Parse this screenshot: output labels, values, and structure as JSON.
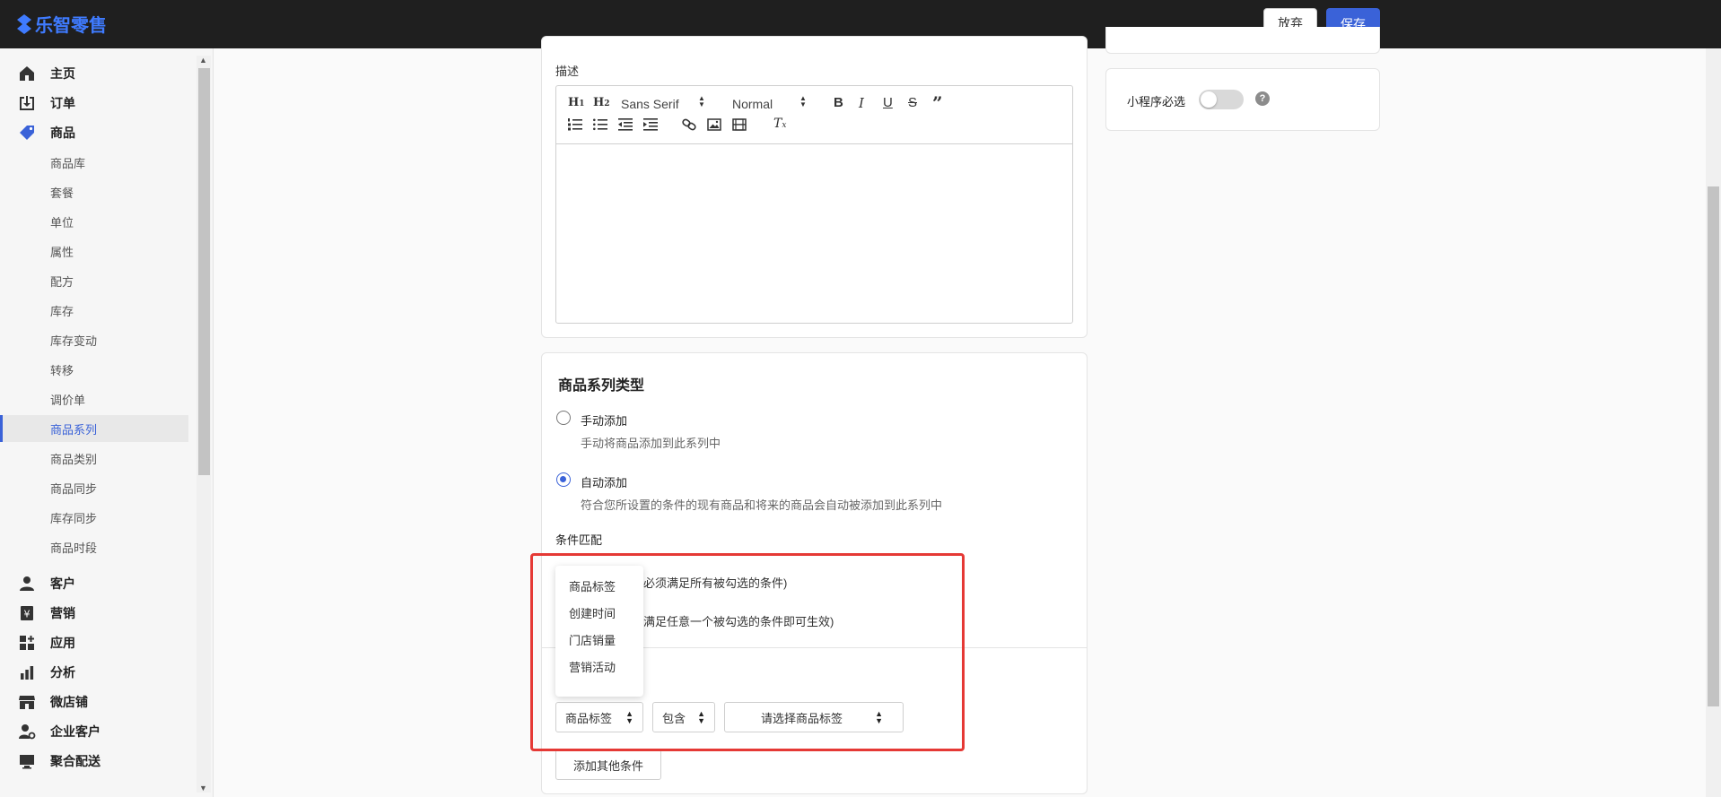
{
  "header": {
    "brand": "乐智零售",
    "discard_label": "放弃",
    "save_label": "保存"
  },
  "sidebar": {
    "main_items": [
      {
        "label": "主页",
        "icon": "home-icon"
      },
      {
        "label": "订单",
        "icon": "download-icon"
      },
      {
        "label": "商品",
        "icon": "tag-icon"
      }
    ],
    "sub_items": [
      "商品库",
      "套餐",
      "单位",
      "属性",
      "配方",
      "库存",
      "库存变动",
      "转移",
      "调价单",
      "商品系列",
      "商品类别",
      "商品同步",
      "库存同步",
      "商品时段"
    ],
    "active_sub": "商品系列",
    "more_items": [
      {
        "label": "客户",
        "icon": "person-icon"
      },
      {
        "label": "营销",
        "icon": "yen-icon"
      },
      {
        "label": "应用",
        "icon": "apps-icon"
      },
      {
        "label": "分析",
        "icon": "bar-chart-icon"
      },
      {
        "label": "微店铺",
        "icon": "store-icon"
      },
      {
        "label": "企业客户",
        "icon": "user-cog-icon"
      },
      {
        "label": "聚合配送",
        "icon": "monitor-icon"
      }
    ]
  },
  "description": {
    "label": "描述",
    "font_family": "Sans Serif",
    "font_size": "Normal"
  },
  "series_type": {
    "title": "商品系列类型",
    "manual_label": "手动添加",
    "manual_desc": "手动将商品添加到此系列中",
    "auto_label": "自动添加",
    "auto_desc": "符合您所设置的条件的现有商品和将来的商品会自动被添加到此系列中",
    "selected": "auto"
  },
  "conditions": {
    "label": "条件匹配",
    "all_text": "必须满足所有被勾选的条件)",
    "any_text": "满足任意一个被勾选的条件即可生效)",
    "field_value": "商品标签",
    "operator_value": "包含",
    "tag_placeholder": "请选择商品标签",
    "add_button": "添加其他条件",
    "dropdown_options": [
      "商品标签",
      "创建时间",
      "门店销量",
      "营销活动"
    ]
  },
  "side_panel": {
    "mini_program_label": "小程序必选",
    "mini_program_enabled": false
  },
  "colors": {
    "accent": "#3a62d8",
    "highlight": "#e53935",
    "topbar": "#1f1f1f"
  }
}
